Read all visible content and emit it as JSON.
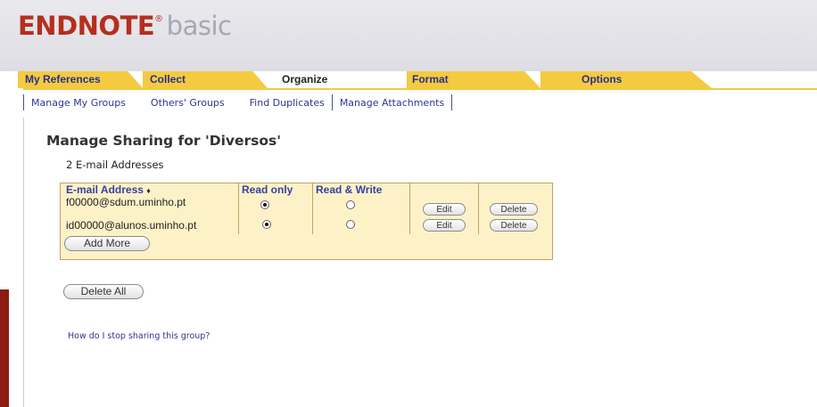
{
  "app": {
    "logo_brand": "ENDNOTE",
    "logo_mark": "®",
    "logo_edition": "basic"
  },
  "tabs": [
    {
      "label": "My References",
      "active": false
    },
    {
      "label": "Collect",
      "active": false
    },
    {
      "label": "Organize",
      "active": true
    },
    {
      "label": "Format",
      "active": false
    },
    {
      "label": "Options",
      "active": false
    }
  ],
  "subnav": [
    "Manage My Groups",
    "Others' Groups",
    "Find Duplicates",
    "Manage Attachments"
  ],
  "page": {
    "title": "Manage Sharing for 'Diversos'",
    "count_label": "2 E-mail Addresses"
  },
  "table": {
    "headers": {
      "email": "E-mail Address",
      "sort_icon": "♦",
      "read_only": "Read only",
      "read_write": "Read & Write"
    },
    "rows": [
      {
        "email": "f00000@sdum.uminho.pt",
        "permission": "read_only"
      },
      {
        "email": "id00000@alunos.uminho.pt",
        "permission": "read_only"
      }
    ],
    "edit_label": "Edit",
    "delete_label": "Delete",
    "add_more_label": "Add More"
  },
  "delete_all_label": "Delete All",
  "help_link": "How do I stop sharing this group?",
  "colors": {
    "brand": "#b62e1d",
    "tab_yellow": "#f4ca40",
    "link_blue": "#2f3592",
    "table_bg": "#fdf2c7"
  }
}
